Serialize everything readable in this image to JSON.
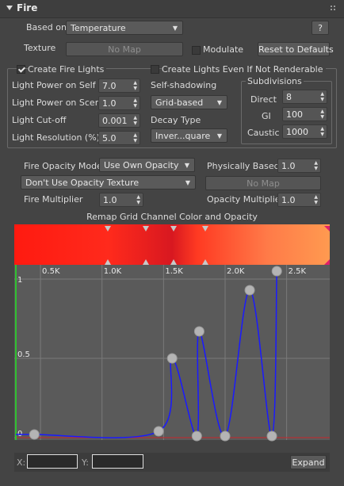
{
  "header": {
    "title": "Fire",
    "collapse_icon": "triangle-down-icon",
    "grip_icon": "dots-grip-icon"
  },
  "based_on": {
    "label": "Based on",
    "value": "Temperature",
    "help_label": "?"
  },
  "texture": {
    "label": "Texture",
    "map_label": "No Map",
    "modulate_label": "Modulate",
    "modulate_checked": false,
    "reset_label": "Reset to Defaults"
  },
  "lights": {
    "create_fire_lights_label": "Create Fire Lights",
    "create_fire_lights_checked": true,
    "even_if_label": "Create Lights Even If Not Renderable",
    "even_if_checked": false,
    "light_power_on_self": {
      "label": "Light Power on Self",
      "value": "7.0"
    },
    "light_power_on_scene": {
      "label": "Light Power on Scene",
      "value": "1.0"
    },
    "light_cutoff": {
      "label": "Light Cut-off",
      "value": "0.001"
    },
    "light_resolution": {
      "label": "Light Resolution (%)",
      "value": "5.0"
    },
    "self_shadowing": {
      "label": "Self-shadowing",
      "value": "Grid-based"
    },
    "decay_type": {
      "label": "Decay Type",
      "value": "Inver...quare"
    },
    "subdivisions": {
      "title": "Subdivisions",
      "direct": {
        "label": "Direct",
        "value": "8"
      },
      "gi": {
        "label": "GI",
        "value": "100"
      },
      "caustic": {
        "label": "Caustic",
        "value": "1000"
      }
    }
  },
  "opacity": {
    "mode_label": "Fire Opacity Mode",
    "mode_value": "Use Own Opacity",
    "physically_based_label": "Physically Based",
    "physically_based_value": "1.0",
    "texture_option": "Don't Use Opacity Texture",
    "no_map_label": "No Map",
    "fire_multiplier_label": "Fire Multiplier",
    "fire_multiplier_value": "1.0",
    "opacity_multiplier_label": "Opacity Multiplier",
    "opacity_multiplier_value": "1.0"
  },
  "curve_editor": {
    "title": "Remap Grid Channel Color and Opacity",
    "gradient_colors": [
      "#ff1a10",
      "#ff2a1c",
      "#d81820",
      "#ff3a22",
      "#ff7a48",
      "#ff9a50"
    ],
    "x_ticks": [
      "0.5K",
      "1.0K",
      "1.5K",
      "2.0K",
      "2.5K"
    ],
    "y_ticks": [
      "1",
      "0.5",
      "0"
    ],
    "curve_color": "#1a1aff",
    "x_label": "X:",
    "y_label": "Y:",
    "x_value": "",
    "y_value": "",
    "expand_label": "Expand"
  },
  "chart_data": {
    "type": "line",
    "title": "Remap Grid Channel Color and Opacity",
    "xlabel": "",
    "ylabel": "",
    "xlim": [
      300,
      2850
    ],
    "ylim": [
      0,
      1
    ],
    "x_tick_labels": [
      "0.5K",
      "1.0K",
      "1.5K",
      "2.0K",
      "2.5K"
    ],
    "y_tick_labels": [
      "0",
      "0.5",
      "1"
    ],
    "grid": true,
    "series": [
      {
        "x": [
          450,
          1460,
          1570,
          1770,
          1790,
          2000,
          2200,
          2380,
          2420
        ],
        "y": [
          0.02,
          0.04,
          0.5,
          0.01,
          0.67,
          0.01,
          0.93,
          0.01,
          1.05
        ]
      }
    ]
  }
}
